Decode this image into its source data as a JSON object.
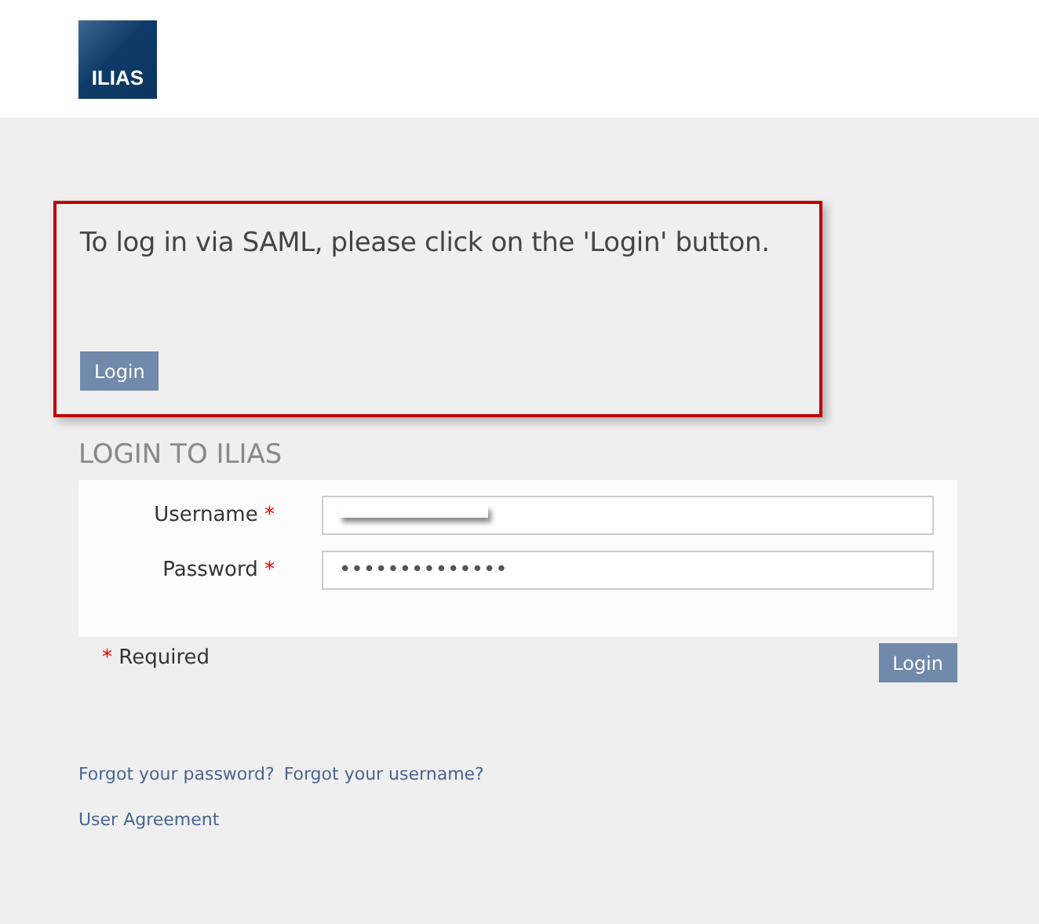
{
  "header": {
    "logo": "ILIAS"
  },
  "saml": {
    "message": "To log in via SAML, please click on the 'Login' button.",
    "button": "Login"
  },
  "login": {
    "title": "LOGIN TO ILIAS",
    "fields": [
      {
        "label": "Username",
        "required": true,
        "kind": "redacted"
      },
      {
        "label": "Password",
        "required": true,
        "kind": "text",
        "value": "••••••••••••••"
      }
    ],
    "required_note": {
      "mark": "*",
      "text": "Required"
    },
    "button": "Login"
  },
  "links": [
    [
      "Forgot your password?",
      "Forgot your username?"
    ],
    [
      "User Agreement"
    ]
  ]
}
